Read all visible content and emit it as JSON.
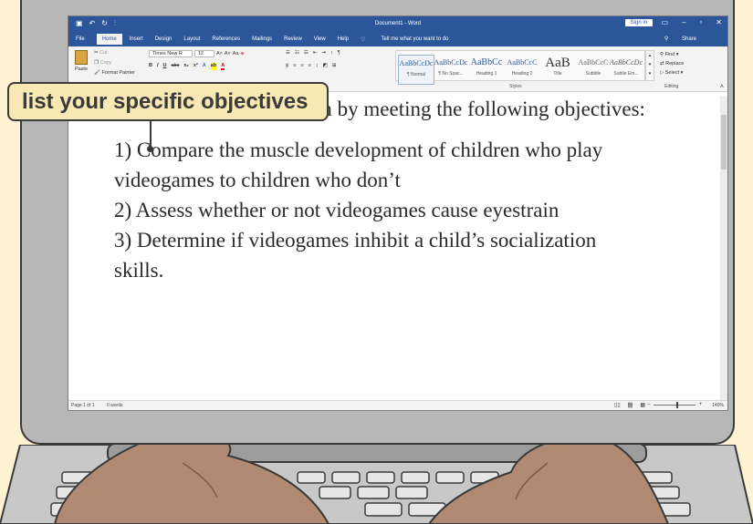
{
  "window": {
    "title": "Document1 - Word",
    "sign_in": "Sign in",
    "controls": [
      "–",
      "▫",
      "✕"
    ]
  },
  "menu": {
    "items": [
      "File",
      "Home",
      "Insert",
      "Design",
      "Layout",
      "References",
      "Mailings",
      "Review",
      "View",
      "Help"
    ],
    "tell_me": "Tell me what you want to do",
    "share": "Share"
  },
  "ribbon": {
    "clipboard": {
      "paste": "Paste",
      "cut": "Cut",
      "copy": "Copy",
      "format_painter": "Format Painter"
    },
    "font": {
      "name": "Times New R",
      "size": "12"
    },
    "styles": [
      {
        "sample": "AaBbCcDc",
        "name": "¶ Normal"
      },
      {
        "sample": "AaBbCcDc",
        "name": "¶ No Spac..."
      },
      {
        "sample": "AaBbCc",
        "name": "Heading 1"
      },
      {
        "sample": "AaBbCcC",
        "name": "Heading 2"
      },
      {
        "sample": "AaB",
        "name": "Title"
      },
      {
        "sample": "AaBbCcC",
        "name": "Subtitle"
      },
      {
        "sample": "AaBbCcDc",
        "name": "Subtle Em..."
      }
    ],
    "styles_label": "Styles",
    "editing": {
      "find": "Find",
      "replace": "Replace",
      "select": "Select",
      "label": "Editing"
    }
  },
  "callout": {
    "text": "list your specific objectives"
  },
  "document": {
    "intro": "I will accomplish this aim by meeting the following objectives:",
    "line1": "1) Compare the muscle development of children who play",
    "line1b": "videogames to children who don’t",
    "line2": "2) Assess whether or not videogames cause eyestrain",
    "line3": "3) Determine if videogames inhibit a child’s socialization",
    "line3b": "skills."
  },
  "status": {
    "page": "Page 1 of 1",
    "words": "0 words",
    "zoom": "140%"
  },
  "colors": {
    "word_blue": "#2b579a",
    "callout_fill": "#f8e9b4",
    "background": "#fdf3d2",
    "skin": "#b08a73"
  }
}
